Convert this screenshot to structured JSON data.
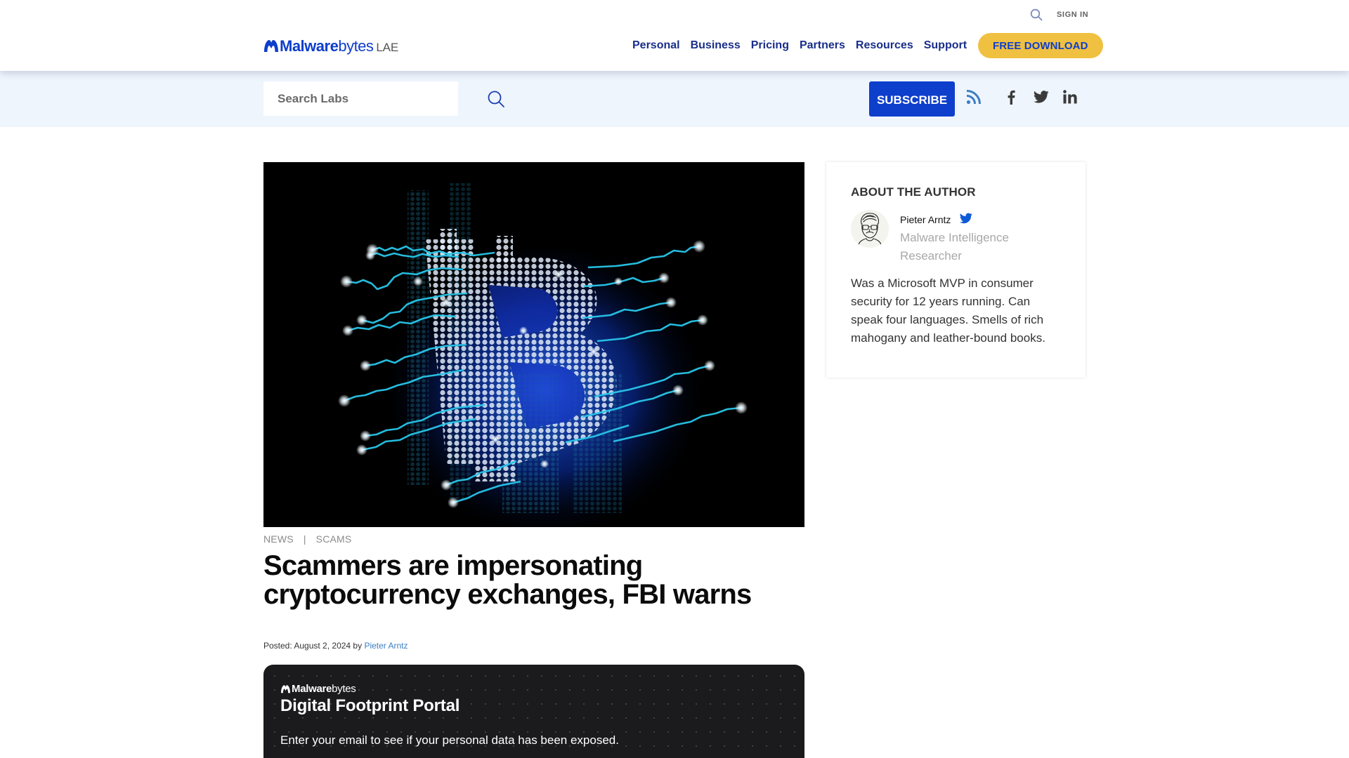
{
  "header": {
    "logo": {
      "bold": "Malware",
      "light": "bytes",
      "suffix": "LAE"
    },
    "utility": {
      "search_icon": "search-icon",
      "sign_in": "SIGN IN"
    },
    "nav": [
      {
        "label": "Personal"
      },
      {
        "label": "Business"
      },
      {
        "label": "Pricing"
      },
      {
        "label": "Partners"
      },
      {
        "label": "Resources"
      },
      {
        "label": "Support"
      }
    ],
    "download_label": "FREE DOWNLOAD"
  },
  "labs_bar": {
    "search_placeholder": "Search Labs",
    "search_value": "",
    "subscribe_label": "SUBSCRIBE",
    "social_icons": [
      "rss-icon",
      "facebook-icon",
      "twitter-icon",
      "linkedin-icon"
    ]
  },
  "article": {
    "hero_image": "bitcoin-circuit-illustration",
    "categories": [
      "NEWS",
      "SCAMS"
    ],
    "category_separator": "|",
    "title": "Scammers are impersonating cryptocurrency exchanges, FBI warns",
    "posted_prefix": "Posted: August 2, 2024 by ",
    "author_link": "Pieter Arntz"
  },
  "promo": {
    "logo_bold": "Malware",
    "logo_light": "bytes",
    "title": "Digital Footprint Portal",
    "description": "Enter your email to see if your personal data has been exposed."
  },
  "author_card": {
    "heading": "ABOUT THE AUTHOR",
    "name": "Pieter Arntz",
    "role": "Malware Intelligence Researcher",
    "bio": "Was a Microsoft MVP in consumer security for 12 years running. Can speak four languages. Smells of rich mahogany and leather-bound books."
  },
  "colors": {
    "brand_blue": "#0d3ecc",
    "nav_text": "#1a2e8a",
    "download_yellow": "#f0c040",
    "labs_bar_bg": "#eef5fd",
    "link_blue": "#3b7dc4",
    "twitter_blue": "#0d5bd8"
  }
}
